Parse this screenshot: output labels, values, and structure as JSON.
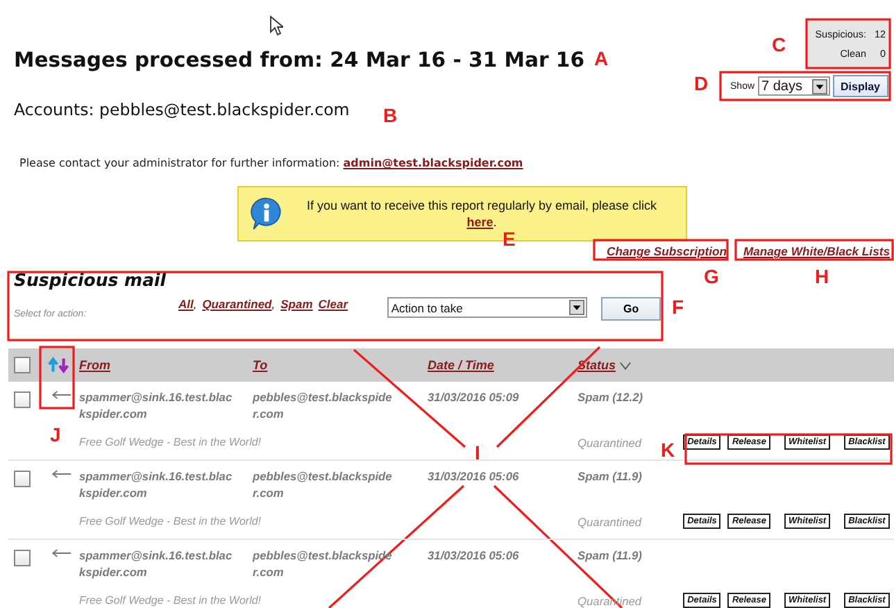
{
  "title": "Messages processed from: 24 Mar 16 - 31 Mar 16",
  "accounts": "Accounts: pebbles@test.blackspider.com",
  "summary": [
    {
      "label": "Suspicious:",
      "count": "12"
    },
    {
      "label": "Clean",
      "count": "0"
    }
  ],
  "period": {
    "label": "Show",
    "value": "7 days",
    "button": "Display"
  },
  "contact": {
    "text": "Please contact your administrator for further information:",
    "link": "admin@test.blackspider.com"
  },
  "banner": {
    "text": "If you want to receive this report regularly by email, please click",
    "link": "here",
    "after": "."
  },
  "links": [
    "Change Subscription",
    "Manage White/Black Lists"
  ],
  "panel": {
    "title": "Suspicious mail",
    "select_label": "Select for action:",
    "filters": [
      {
        "label": "All",
        "separator": ","
      },
      {
        "label": "Quarantined",
        "separator": ","
      },
      {
        "label": "Spam"
      },
      {
        "label": "Clear"
      }
    ],
    "action": "Action to take",
    "button": "Go"
  },
  "table": {
    "select_all_checked": false,
    "columns": [
      "From",
      "To",
      "Date / Time",
      "Status"
    ],
    "rows": [
      {
        "checked": false,
        "from": "spammer@sink.16.test.blackspider.com",
        "to": "pebbles@test.blackspider.com",
        "date": "31/03/2016 05:09",
        "status": "Spam (12.2)",
        "subject": "Free Golf Wedge - Best in the World!",
        "disposition": "Quarantined",
        "actions": [
          "Details",
          "Release",
          "Whitelist",
          "Blacklist"
        ]
      },
      {
        "checked": false,
        "from": "spammer@sink.16.test.blackspider.com",
        "to": "pebbles@test.blackspider.com",
        "date": "31/03/2016 05:06",
        "status": "Spam (11.9)",
        "subject": "Free Golf Wedge - Best in the World!",
        "disposition": "Quarantined",
        "actions": [
          "Details",
          "Release",
          "Whitelist",
          "Blacklist"
        ]
      },
      {
        "checked": false,
        "from": "spammer@sink.16.test.blackspider.com",
        "to": "pebbles@test.blackspider.com",
        "date": "31/03/2016 05:06",
        "status": "Spam (11.9)",
        "subject": "Free Golf Wedge - Best in the World!",
        "disposition": "Quarantined",
        "actions": [
          "Details",
          "Release",
          "Whitelist",
          "Blacklist"
        ]
      }
    ]
  },
  "annotations": [
    {
      "label": "A"
    },
    {
      "label": "B"
    },
    {
      "label": "C"
    },
    {
      "label": "D"
    },
    {
      "label": "E"
    },
    {
      "label": "F"
    },
    {
      "label": "G"
    },
    {
      "label": "H"
    },
    {
      "label": "I"
    },
    {
      "label": "J"
    },
    {
      "label": "K"
    }
  ]
}
